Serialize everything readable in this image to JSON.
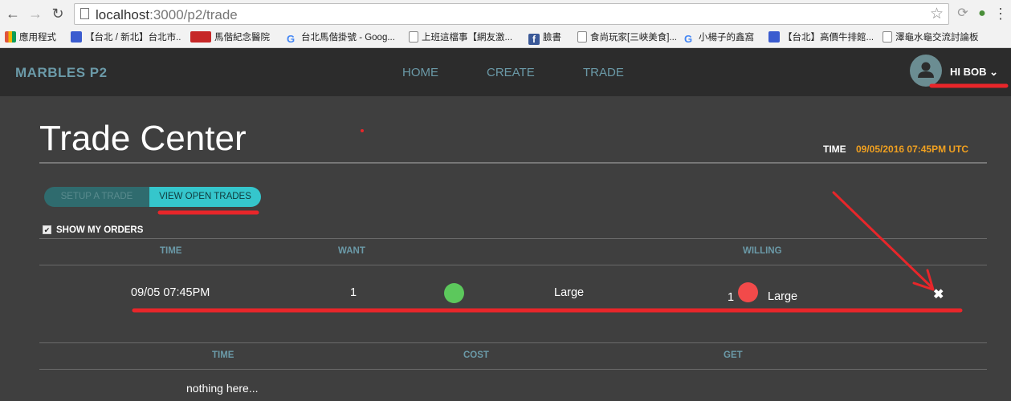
{
  "browser": {
    "url_host": "localhost",
    "url_path": ":3000/p2/trade",
    "bookmarks": [
      {
        "label": "應用程式",
        "icon": "apps-grid-icon",
        "color": "#e0533c"
      },
      {
        "label": "【台北 / 新北】台北市...",
        "icon": "bookmark-blue-icon",
        "color": "#3b5ccf"
      },
      {
        "label": "馬偕紀念醫院",
        "icon": "hospital-logo-icon",
        "color": "#c62828"
      },
      {
        "label": "台北馬偕掛號 - Goog...",
        "icon": "google-icon",
        "color": "#4285f4"
      },
      {
        "label": "上班這檔事【網友激...",
        "icon": "page-icon",
        "color": "#888888"
      },
      {
        "label": "臉書",
        "icon": "facebook-icon",
        "color": "#3b5998"
      },
      {
        "label": "食尚玩家[三峽美食]...",
        "icon": "page-icon",
        "color": "#888888"
      },
      {
        "label": "小楊子的鑫窩",
        "icon": "google-icon",
        "color": "#4285f4"
      },
      {
        "label": "【台北】高價牛排館...",
        "icon": "bookmark-blue-icon",
        "color": "#3b5ccf"
      },
      {
        "label": "澤龜水龜交流討論板",
        "icon": "page-icon",
        "color": "#888888"
      }
    ]
  },
  "header": {
    "brand": "MARBLES P2",
    "nav": [
      "HOME",
      "CREATE",
      "TRADE"
    ],
    "user_greeting": "HI BOB",
    "user_caret": "⌄"
  },
  "page": {
    "title": "Trade Center",
    "time_label": "TIME",
    "time_value": "09/05/2016  07:45PM UTC"
  },
  "tabs": {
    "setup": "SETUP A TRADE",
    "view_open": "VIEW OPEN TRADES"
  },
  "show_my_orders": {
    "label": "SHOW MY ORDERS",
    "checked": true,
    "check_glyph": "✔"
  },
  "open_trades": {
    "headers": [
      "TIME",
      "WANT",
      "WILLING"
    ],
    "rows": [
      {
        "time": "09/05 07:45PM",
        "want_qty": "1",
        "want_color": "#5cc85c",
        "want_size": "Large",
        "willing_qty": "1",
        "willing_color": "#f24a4a",
        "willing_size": "Large",
        "close_glyph": "✖"
      }
    ]
  },
  "history": {
    "headers": [
      "TIME",
      "COST",
      "GET"
    ],
    "empty_text": "nothing here..."
  },
  "colors": {
    "accent": "#35c6cc",
    "time_orange": "#f0a020",
    "header_text": "#6b9aa8",
    "annotation_red": "#e8262a"
  }
}
